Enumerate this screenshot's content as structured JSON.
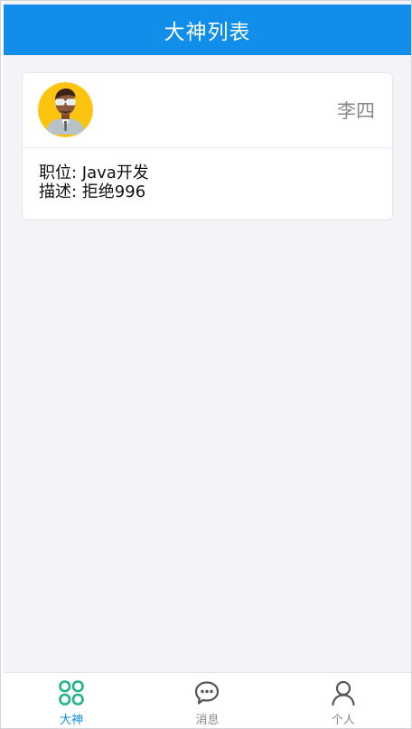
{
  "header": {
    "title": "大神列表"
  },
  "card": {
    "name": "李四",
    "position_line": "职位: Java开发",
    "description_line": "描述: 拒绝996",
    "avatar_icon": "avatar-man-glasses-icon"
  },
  "tabbar": {
    "tabs": [
      {
        "label": "大神",
        "icon": "grid-four-icon",
        "active": true
      },
      {
        "label": "消息",
        "icon": "chat-bubble-icon",
        "active": false
      },
      {
        "label": "个人",
        "icon": "person-icon",
        "active": false
      }
    ]
  },
  "colors": {
    "brand": "#108ee9",
    "active_icon": "#22b38a",
    "inactive": "#888888",
    "background": "#f4f4f8"
  }
}
